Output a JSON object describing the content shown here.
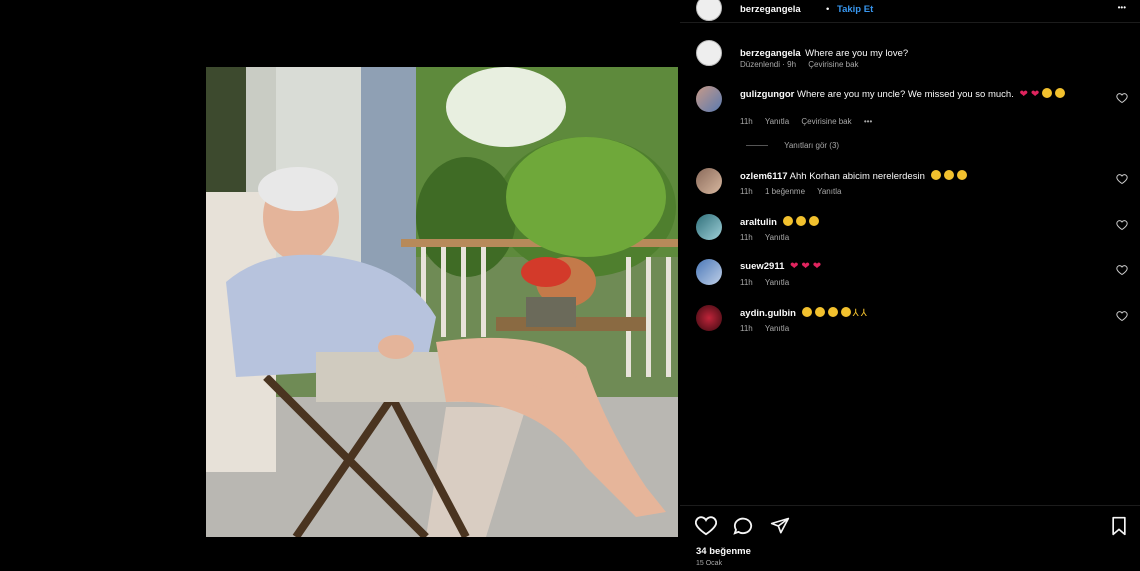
{
  "post": {
    "author": "berzegangela",
    "follow_label": "Takip Et",
    "dot": "•",
    "more": "•••"
  },
  "caption": {
    "user": "berzegangela",
    "text": "Where are you my love?",
    "edited": "Düzenlendi · 9h",
    "translate": "Çevirisine bak"
  },
  "comments": [
    {
      "user": "gulizgungor",
      "text": "Where are you my uncle? We missed you so much.",
      "emojis": [
        "red-heart",
        "red-heart",
        "smile",
        "smile"
      ],
      "time": "11h",
      "reply": "Yanıtla",
      "translate": "Çevirisine bak",
      "more": "•••",
      "view_replies": "Yanıtları gör (3)"
    },
    {
      "user": "ozlem6117",
      "text": "Ahh Korhan abicim nerelerdesin",
      "emojis": [
        "smile",
        "smile",
        "smile"
      ],
      "time": "11h",
      "likes": "1 beğenme",
      "reply": "Yanıtla"
    },
    {
      "user": "araltulin",
      "text": "",
      "emojis": [
        "smile",
        "smile",
        "smile"
      ],
      "time": "11h",
      "reply": "Yanıtla"
    },
    {
      "user": "suew2911",
      "text": "",
      "emojis": [
        "red-heart",
        "red-heart",
        "red-heart"
      ],
      "time": "11h",
      "reply": "Yanıtla"
    },
    {
      "user": "aydin.gulbin",
      "text": "",
      "emojis": [
        "smile",
        "smile",
        "smile",
        "smile",
        "pray",
        "pray"
      ],
      "time": "11h",
      "reply": "Yanıtla"
    }
  ],
  "footer": {
    "likes": "34 beğenme",
    "date": "15 Ocak"
  },
  "icons": [
    "heart-icon",
    "comment-icon",
    "share-icon",
    "bookmark-icon"
  ],
  "colors": {
    "background": "#000000",
    "link": "#3897f0",
    "muted": "#a8a8a8",
    "heart": "#e0245e"
  }
}
